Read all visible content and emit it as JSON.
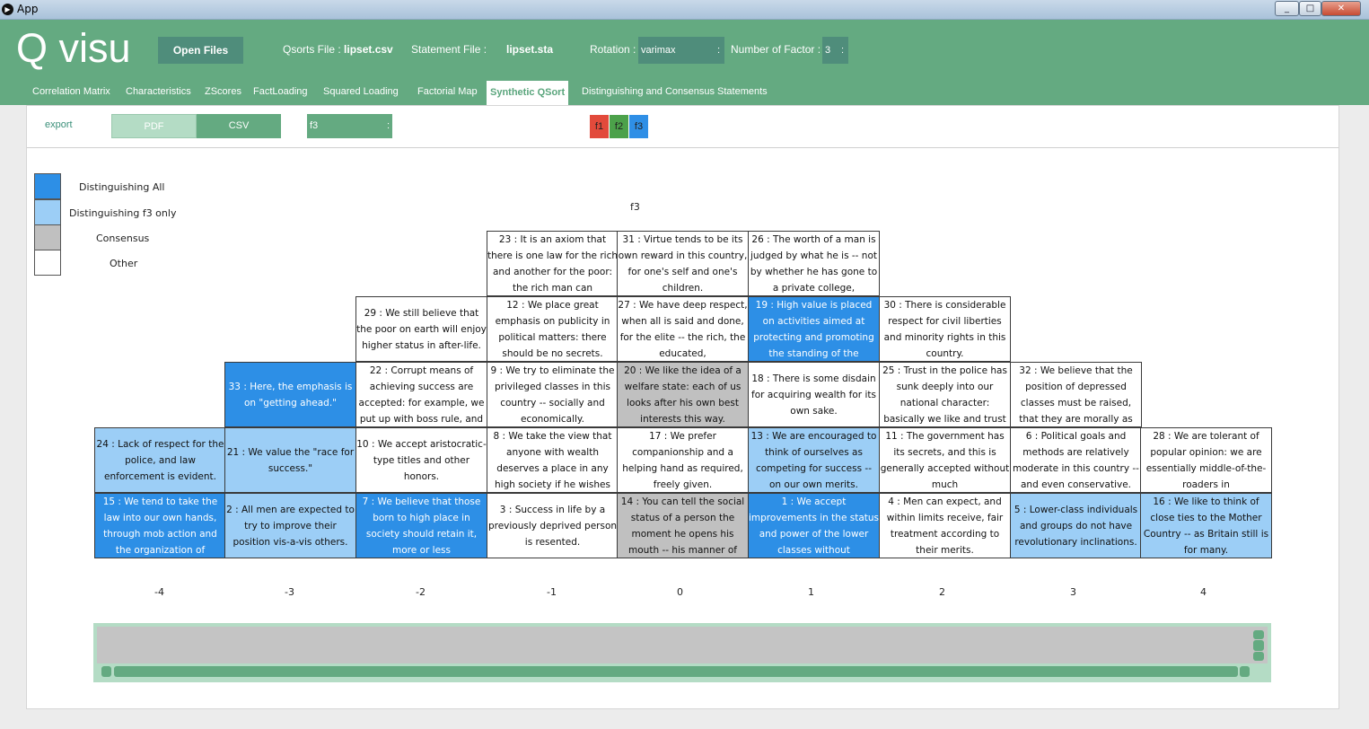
{
  "window": {
    "title": "App",
    "icon": "app-icon",
    "controls": [
      "_",
      "□",
      "✕"
    ]
  },
  "header": {
    "logo": "Q visu",
    "open_files": "Open Files",
    "qsorts_label": "Qsorts File :",
    "qsorts_file": "lipset.csv",
    "statement_label": "Statement File :",
    "statement_file": "lipset.sta",
    "rotation_label": "Rotation :",
    "rotation_value": "varimax",
    "factors_label": "Number of Factor :",
    "factors_value": "3",
    "select_arrow": ":"
  },
  "tabs": [
    "Correlation Matrix",
    "Characteristics",
    "ZScores",
    "FactLoading",
    "Squared Loading",
    "Factorial Map",
    "Synthetic QSort",
    "Distinguishing and Consensus Statements"
  ],
  "active_tab": "Synthetic QSort",
  "toolbar": {
    "export": "export",
    "pdf": "PDF",
    "csv": "CSV",
    "factor": "f3",
    "factor_buttons": [
      {
        "label": "f1",
        "color": "#e24a3b"
      },
      {
        "label": "f2",
        "color": "#4ca14a"
      },
      {
        "label": "f3",
        "color": "#2f8fe6"
      }
    ]
  },
  "legend": [
    {
      "label": "Distinguishing All",
      "color": "#2d8fe6"
    },
    {
      "label": "Distinguishing f3 only",
      "color": "#9ccef6"
    },
    {
      "label": "Consensus",
      "color": "#c0c0c0"
    },
    {
      "label": "Other",
      "color": "#ffffff"
    }
  ],
  "grid_title": "f3",
  "scores": [
    "-4",
    "-3",
    "-2",
    "-1",
    "0",
    "1",
    "2",
    "3",
    "4"
  ],
  "columns": [
    [
      {
        "text": "15 : We tend to take the law into our own hands, through mob action and the organization of",
        "type": "all"
      },
      {
        "text": "24 : Lack of respect for the police, and law enforcement is evident.",
        "type": "f3"
      }
    ],
    [
      {
        "text": "2 : All men are expected to try to improve their position vis-a-vis others.",
        "type": "f3"
      },
      {
        "text": "21 : We value the \"race for success.\"",
        "type": "f3"
      },
      {
        "text": "33 : Here, the emphasis is on \"getting ahead.\"",
        "type": "all"
      }
    ],
    [
      {
        "text": "7 : We believe that those born to high place in society should retain it, more or less",
        "type": "all"
      },
      {
        "text": "10 : We accept aristocratic-type titles and other honors.",
        "type": "other"
      },
      {
        "text": "22 : Corrupt means of achieving success are accepted: for example, we put up with boss rule, and",
        "type": "other"
      },
      {
        "text": "29 : We still believe that the poor on earth will enjoy higher status in after-life.",
        "type": "other"
      }
    ],
    [
      {
        "text": "3 : Success in life by a previously deprived person is resented.",
        "type": "other"
      },
      {
        "text": "8 : We take the view that anyone with wealth deserves a place in any high society if he wishes",
        "type": "other"
      },
      {
        "text": "9 : We try to eliminate the privileged classes in this country -- socially and economically.",
        "type": "other"
      },
      {
        "text": "12 : We place great emphasis on publicity in political matters: there should be no secrets.",
        "type": "other"
      },
      {
        "text": "23 : It is an axiom that there is one law for the rich and another for the poor: the rich man can",
        "type": "other"
      }
    ],
    [
      {
        "text": "14 : You can tell the social status of a person the moment he opens his mouth -- his manner of",
        "type": "cons"
      },
      {
        "text": "17 : We prefer companionship and a helping hand as required, freely given.",
        "type": "other"
      },
      {
        "text": "20 : We like the idea of a welfare state: each of us looks after his own best interests this way.",
        "type": "cons"
      },
      {
        "text": "27 : We have deep respect, when all is said and done, for the elite -- the rich, the educated,",
        "type": "other"
      },
      {
        "text": "31 : Virtue tends to be its own reward in this country, for one's self and one's children.",
        "type": "other"
      }
    ],
    [
      {
        "text": "1 : We accept improvements in the status and power of the lower classes without",
        "type": "all"
      },
      {
        "text": "13 : We are encouraged to think of ourselves as competing for success -- on our own merits.",
        "type": "f3"
      },
      {
        "text": "18 : There is some disdain for acquiring wealth for its own sake.",
        "type": "other"
      },
      {
        "text": "19 : High value is placed on activities aimed at protecting and promoting the standing of the",
        "type": "all"
      },
      {
        "text": "26 : The worth of a man is judged by what he is -- not by whether he has gone to a private college,",
        "type": "other"
      }
    ],
    [
      {
        "text": "4 : Men can expect, and within limits receive, fair treatment according to their merits.",
        "type": "other"
      },
      {
        "text": "11 : The government has its secrets, and this is generally accepted without much",
        "type": "other"
      },
      {
        "text": "25 : Trust in the police has sunk deeply into our national character: basically we like and trust",
        "type": "other"
      },
      {
        "text": "30 : There is considerable respect for civil liberties and minority rights in this country.",
        "type": "other"
      }
    ],
    [
      {
        "text": "5 : Lower-class individuals and groups do not have revolutionary inclinations.",
        "type": "f3"
      },
      {
        "text": "6 : Political goals and methods are relatively moderate in this country -- and even conservative.",
        "type": "other"
      },
      {
        "text": "32 : We believe that the position of depressed classes must be raised, that they are morally as",
        "type": "other"
      }
    ],
    [
      {
        "text": "16 : We like to think of close ties to the Mother Country -- as Britain still is for many.",
        "type": "f3"
      },
      {
        "text": "28 : We are tolerant of popular opinion: we are essentially middle-of-the-roaders in",
        "type": "other"
      }
    ]
  ],
  "icons": {
    "scroll_left": "scroll-left-icon",
    "scroll_right": "scroll-right-icon"
  }
}
